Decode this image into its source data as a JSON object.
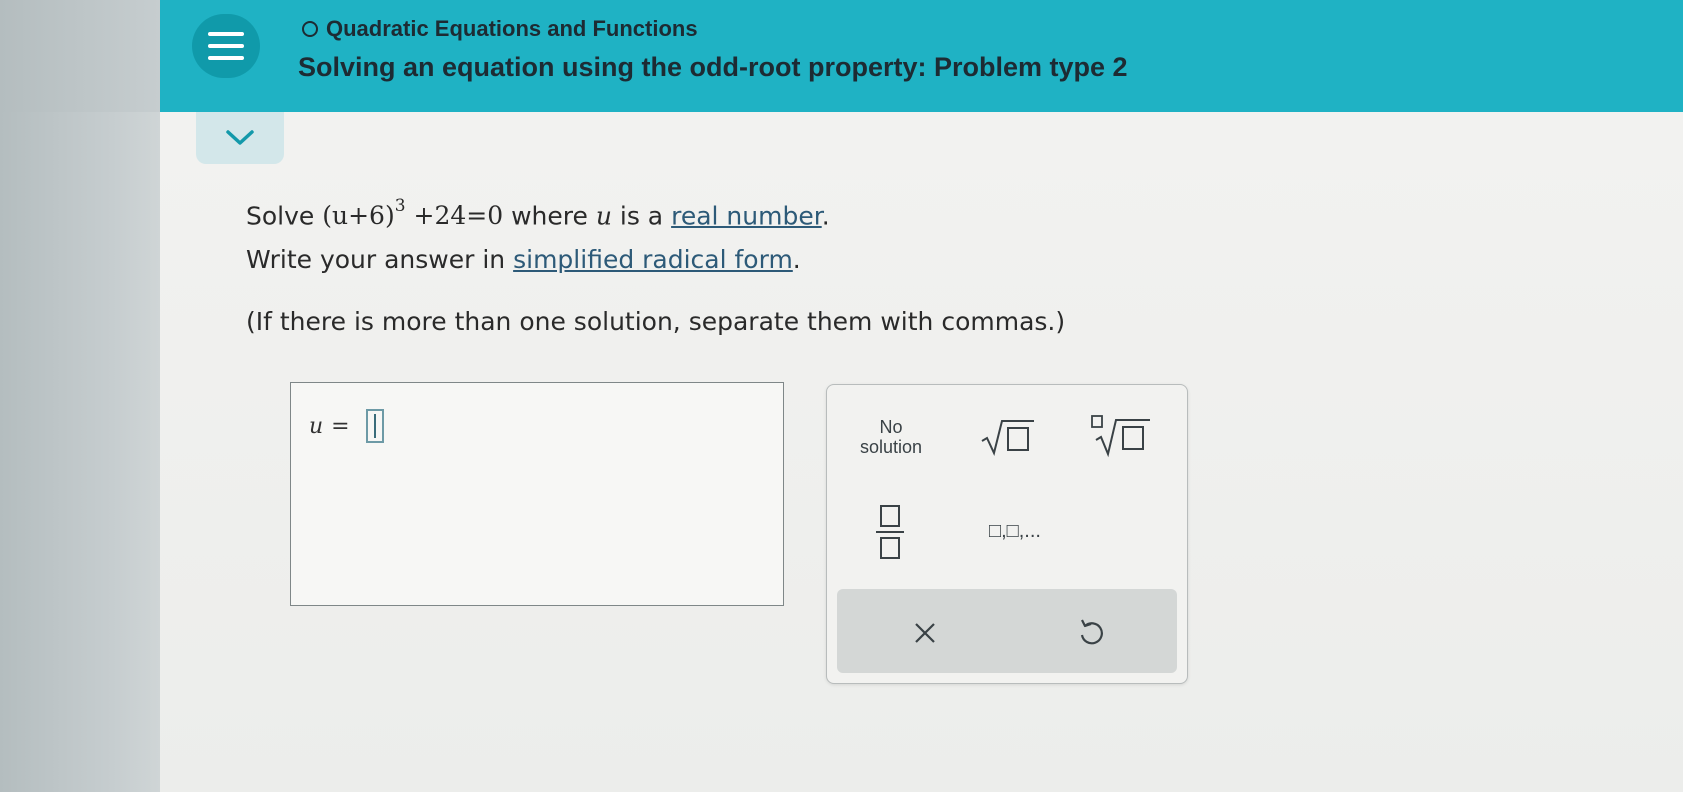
{
  "header": {
    "topic": "Quadratic Equations and Functions",
    "title": "Solving an equation using the odd-root property: Problem type 2"
  },
  "problem": {
    "solve_word": "Solve",
    "equation_open": "(u+6)",
    "equation_exponent": "3",
    "equation_rest": "+24=0",
    "where_text": "where",
    "variable": "u",
    "is_a_text": "is a",
    "real_number_link": "real number",
    "period1": ".",
    "line2_prefix": "Write your answer in",
    "simplified_radical_link": "simplified radical form",
    "period2": ".",
    "line3": "(If there is more than one solution, separate them with commas.)"
  },
  "answer": {
    "variable": "u",
    "equals": "=",
    "value": ""
  },
  "keypad": {
    "no_solution_line1": "No",
    "no_solution_line2": "solution",
    "list_label": "□,□,..."
  },
  "icons": {
    "menu": "hamburger-menu-icon",
    "topic_status": "empty-circle-icon",
    "collapse": "chevron-down-icon",
    "sqrt": "square-root-icon",
    "nthroot": "nth-root-icon",
    "fraction": "fraction-icon",
    "clear": "close-icon",
    "undo": "undo-icon"
  },
  "colors": {
    "header_teal": "#1fb2c4",
    "menu_button": "#109aaa",
    "link": "#2d5a78"
  }
}
